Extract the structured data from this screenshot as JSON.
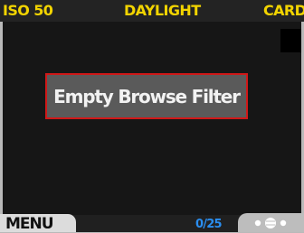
{
  "status": {
    "iso": "ISO 50",
    "white_balance": "DAYLIGHT",
    "storage": "CARD"
  },
  "message": {
    "text": "Empty Browse Filter"
  },
  "footer": {
    "menu_label": "MENU",
    "counter": "0/25"
  },
  "icons": {
    "nav": "navigation-dial-icon"
  },
  "colors": {
    "status_text": "#f2d400",
    "message_border": "#d01818",
    "counter_text": "#2a8ef0",
    "viewport": "#161616"
  }
}
